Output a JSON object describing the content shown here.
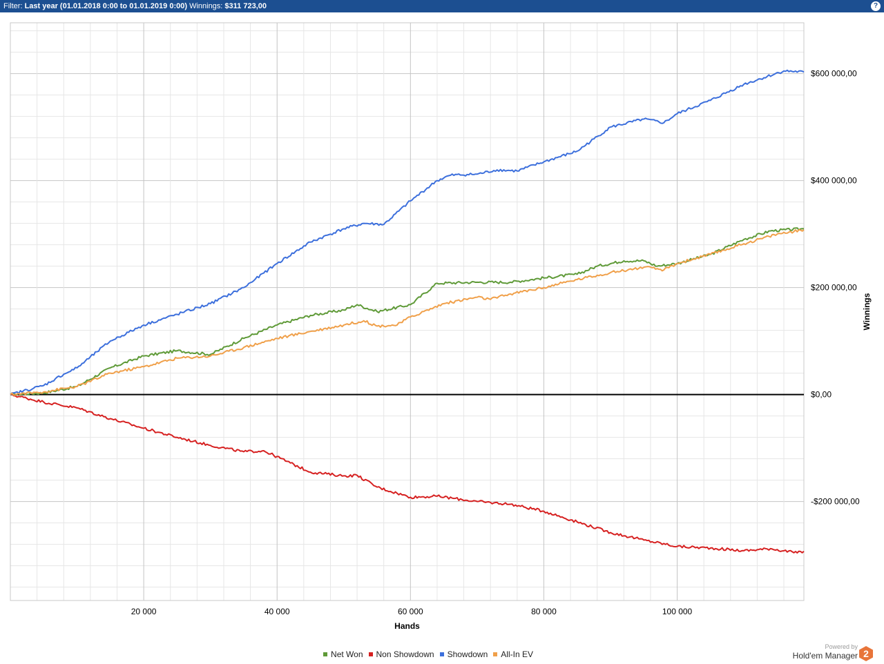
{
  "header": {
    "filter_label": "Filter:",
    "filter_value": "Last year (01.01.2018 0:00 to 01.01.2019 0:00)",
    "winnings_label": "Winnings:",
    "winnings_value": "$311 723,00",
    "help_icon": "question-icon"
  },
  "branding": {
    "powered_by": "Powered by",
    "product": "Hold'em Manager",
    "logo_text": "2",
    "logo_color": "#e8753a"
  },
  "chart_data": {
    "type": "line",
    "xlabel": "Hands",
    "ylabel": "Winnings",
    "xlim": [
      0,
      119000
    ],
    "ylim": [
      -385000,
      695000
    ],
    "x_ticks": [
      20000,
      40000,
      60000,
      80000,
      100000
    ],
    "x_tick_labels": [
      "20 000",
      "40 000",
      "60 000",
      "80 000",
      "100 000"
    ],
    "y_ticks": [
      600000,
      400000,
      200000,
      0,
      -200000
    ],
    "y_tick_labels": [
      "$600 000,00",
      "$400 000,00",
      "$200 000,00",
      "$0,00",
      "-$200 000,00"
    ],
    "grid": true,
    "legend_position": "bottom",
    "series": [
      {
        "name": "Net Won",
        "color": "#5f9a38",
        "x": [
          0,
          5000,
          10000,
          15000,
          20000,
          25000,
          30000,
          35000,
          40000,
          45000,
          50000,
          52000,
          55000,
          60000,
          64000,
          70000,
          75000,
          80000,
          85000,
          88000,
          92000,
          95000,
          97000,
          100000,
          105000,
          110000,
          114000,
          119000
        ],
        "y": [
          0,
          3000,
          15000,
          50000,
          72000,
          82000,
          75000,
          105000,
          130000,
          148000,
          158000,
          168000,
          155000,
          168000,
          208000,
          210000,
          210000,
          218000,
          225000,
          240000,
          250000,
          250000,
          240000,
          245000,
          262000,
          290000,
          306000,
          310000
        ]
      },
      {
        "name": "Non Showdown",
        "color": "#d62020",
        "x": [
          0,
          5000,
          10000,
          15000,
          20000,
          25000,
          30000,
          35000,
          38000,
          42000,
          45000,
          50000,
          52000,
          55000,
          60000,
          64000,
          70000,
          75000,
          80000,
          85000,
          90000,
          95000,
          100000,
          105000,
          110000,
          114000,
          118000,
          119000
        ],
        "y": [
          0,
          -14000,
          -25000,
          -45000,
          -63000,
          -80000,
          -95000,
          -107000,
          -105000,
          -128000,
          -145000,
          -152000,
          -151000,
          -173000,
          -192000,
          -190000,
          -200000,
          -205000,
          -218000,
          -238000,
          -258000,
          -272000,
          -284000,
          -287000,
          -292000,
          -288000,
          -296000,
          -293000
        ]
      },
      {
        "name": "Showdown",
        "color": "#3c6fdc",
        "x": [
          0,
          5000,
          8000,
          10000,
          15000,
          20000,
          25000,
          30000,
          35000,
          40000,
          45000,
          50000,
          53000,
          56000,
          60000,
          64000,
          66000,
          70000,
          73000,
          76000,
          80000,
          85000,
          90000,
          95000,
          98000,
          100000,
          105000,
          110000,
          116000,
          119000
        ],
        "y": [
          0,
          17000,
          38000,
          50000,
          100000,
          130000,
          150000,
          170000,
          200000,
          245000,
          285000,
          310000,
          320000,
          318000,
          362000,
          400000,
          410000,
          412000,
          420000,
          418000,
          435000,
          455000,
          500000,
          515000,
          508000,
          525000,
          550000,
          580000,
          605000,
          603000
        ]
      },
      {
        "name": "All-In EV",
        "color": "#f0a04a",
        "x": [
          0,
          5000,
          10000,
          15000,
          20000,
          25000,
          30000,
          35000,
          40000,
          45000,
          50000,
          53000,
          55000,
          58000,
          60000,
          65000,
          70000,
          72000,
          75000,
          80000,
          85000,
          90000,
          95000,
          98000,
          100000,
          105000,
          110000,
          115000,
          119000
        ],
        "y": [
          0,
          5000,
          15000,
          40000,
          52000,
          68000,
          72000,
          88000,
          105000,
          118000,
          130000,
          138000,
          128000,
          130000,
          145000,
          170000,
          182000,
          178000,
          188000,
          200000,
          215000,
          228000,
          238000,
          233000,
          245000,
          262000,
          282000,
          300000,
          308000
        ]
      }
    ]
  }
}
